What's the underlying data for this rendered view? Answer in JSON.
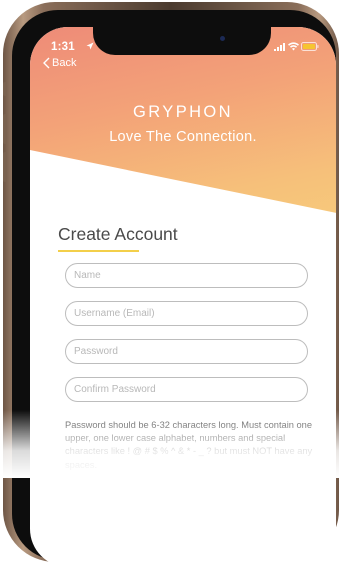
{
  "status_bar": {
    "time": "1:31"
  },
  "nav": {
    "back_label": "Back"
  },
  "brand": {
    "name": "GRYPHON",
    "tagline": "Love The Connection."
  },
  "form": {
    "heading": "Create Account",
    "fields": [
      {
        "placeholder": "Name",
        "value": ""
      },
      {
        "placeholder": "Username (Email)",
        "value": ""
      },
      {
        "placeholder": "Password",
        "value": ""
      },
      {
        "placeholder": "Confirm Password",
        "value": ""
      }
    ],
    "password_help": "Password should be 6-32 characters long. Must contain one upper, one lower case alphabet, numbers and special characters like ! @ # $ % ^ & * - _ ? but must NOT have any spaces."
  },
  "colors": {
    "gradient_start": "#ee8b78",
    "gradient_end": "#f8d07c",
    "accent_underline": "#f3cf4a"
  }
}
